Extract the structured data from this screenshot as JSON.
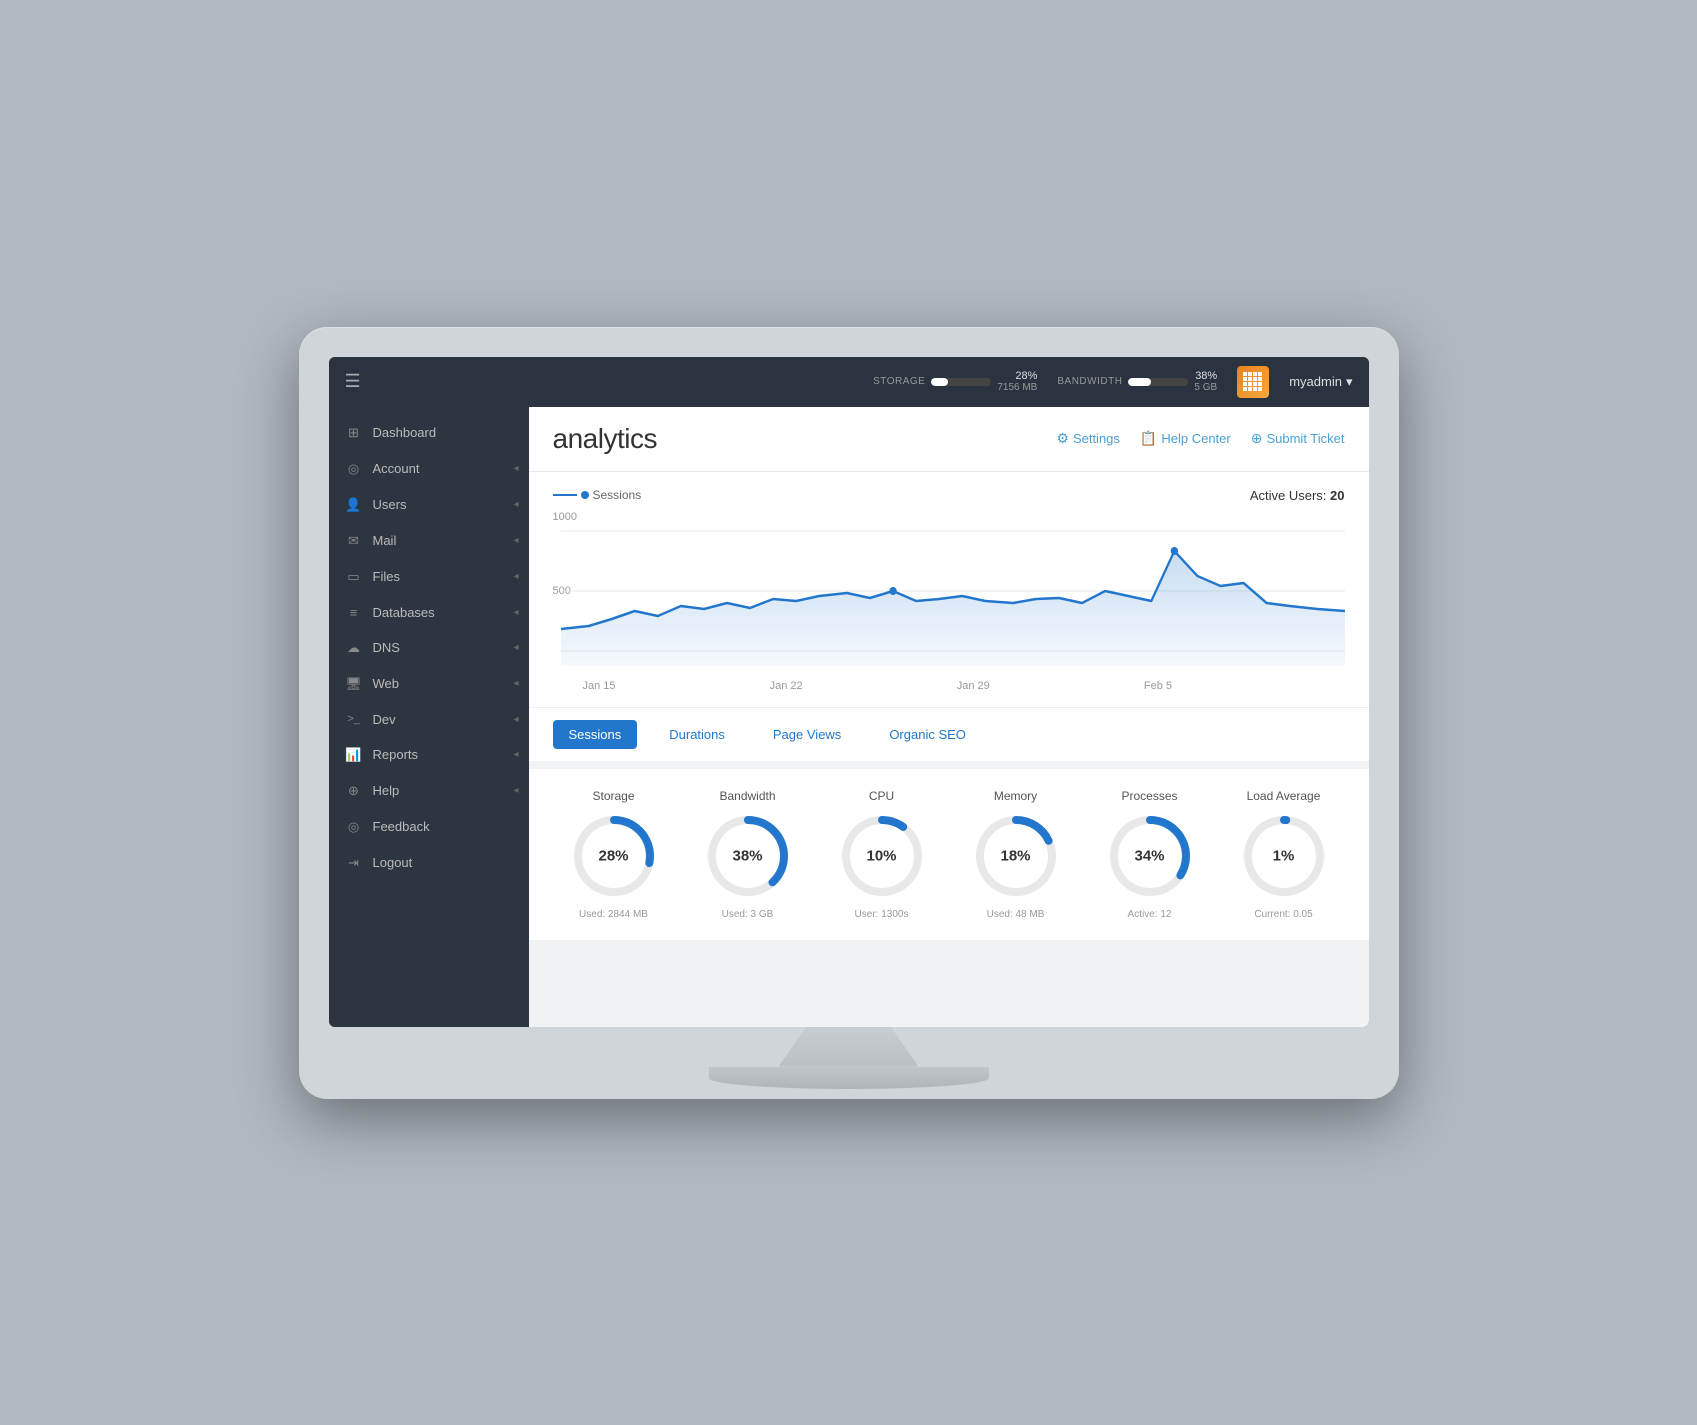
{
  "topbar": {
    "hamburger": "☰",
    "storage_label": "STORAGE",
    "storage_pct": "28%",
    "storage_size": "7156 MB",
    "storage_fill": 28,
    "bandwidth_label": "BANDWIDTH",
    "bandwidth_pct": "38%",
    "bandwidth_size": "5 GB",
    "bandwidth_fill": 38,
    "user_name": "myadmin",
    "user_dropdown": "▾"
  },
  "sidebar": {
    "items": [
      {
        "id": "dashboard",
        "label": "Dashboard",
        "icon": "⊞",
        "arrow": false
      },
      {
        "id": "account",
        "label": "Account",
        "icon": "◎",
        "arrow": true
      },
      {
        "id": "users",
        "label": "Users",
        "icon": "👤",
        "arrow": true
      },
      {
        "id": "mail",
        "label": "Mail",
        "icon": "✉",
        "arrow": true
      },
      {
        "id": "files",
        "label": "Files",
        "icon": "⬜",
        "arrow": true
      },
      {
        "id": "databases",
        "label": "Databases",
        "icon": "☰",
        "arrow": true
      },
      {
        "id": "dns",
        "label": "DNS",
        "icon": "☁",
        "arrow": true
      },
      {
        "id": "web",
        "label": "Web",
        "icon": "🖥",
        "arrow": true
      },
      {
        "id": "dev",
        "label": "Dev",
        "icon": ">_",
        "arrow": true
      },
      {
        "id": "reports",
        "label": "Reports",
        "icon": "📊",
        "arrow": true
      },
      {
        "id": "help",
        "label": "Help",
        "icon": "⊕",
        "arrow": true
      },
      {
        "id": "feedback",
        "label": "Feedback",
        "icon": "◎",
        "arrow": false
      },
      {
        "id": "logout",
        "label": "Logout",
        "icon": "→",
        "arrow": false
      }
    ]
  },
  "header": {
    "title": "analytics",
    "actions": [
      {
        "id": "settings",
        "label": "Settings",
        "icon": "⚙"
      },
      {
        "id": "help-center",
        "label": "Help Center",
        "icon": "📋"
      },
      {
        "id": "submit-ticket",
        "label": "Submit Ticket",
        "icon": "⊕"
      }
    ]
  },
  "chart": {
    "legend_label": "Sessions",
    "active_users_label": "Active Users:",
    "active_users_count": "20",
    "y_labels": [
      "1000",
      "500",
      ""
    ],
    "x_labels": [
      "Jan 15",
      "Jan 22",
      "Jan 29",
      "Feb 5"
    ]
  },
  "tabs": [
    {
      "id": "sessions",
      "label": "Sessions",
      "active": true
    },
    {
      "id": "durations",
      "label": "Durations",
      "active": false
    },
    {
      "id": "pageviews",
      "label": "Page Views",
      "active": false
    },
    {
      "id": "seo",
      "label": "Organic SEO",
      "active": false
    }
  ],
  "metrics": [
    {
      "id": "storage",
      "label": "Storage",
      "pct": 28,
      "display": "28%",
      "sub": "Used: 2844 MB"
    },
    {
      "id": "bandwidth",
      "label": "Bandwidth",
      "pct": 38,
      "display": "38%",
      "sub": "Used: 3 GB"
    },
    {
      "id": "cpu",
      "label": "CPU",
      "pct": 10,
      "display": "10%",
      "sub": "User: 1300s"
    },
    {
      "id": "memory",
      "label": "Memory",
      "pct": 18,
      "display": "18%",
      "sub": "Used: 48 MB"
    },
    {
      "id": "processes",
      "label": "Processes",
      "pct": 34,
      "display": "34%",
      "sub": "Active: 12"
    },
    {
      "id": "load",
      "label": "Load Average",
      "pct": 1,
      "display": "1%",
      "sub": "Current: 0.05"
    }
  ],
  "colors": {
    "accent": "#2277cc",
    "sidebar_bg": "#2d3540",
    "topbar_bg": "#2b3340",
    "content_bg": "#f0f2f4",
    "donut_bg": "#e8e8e8"
  }
}
